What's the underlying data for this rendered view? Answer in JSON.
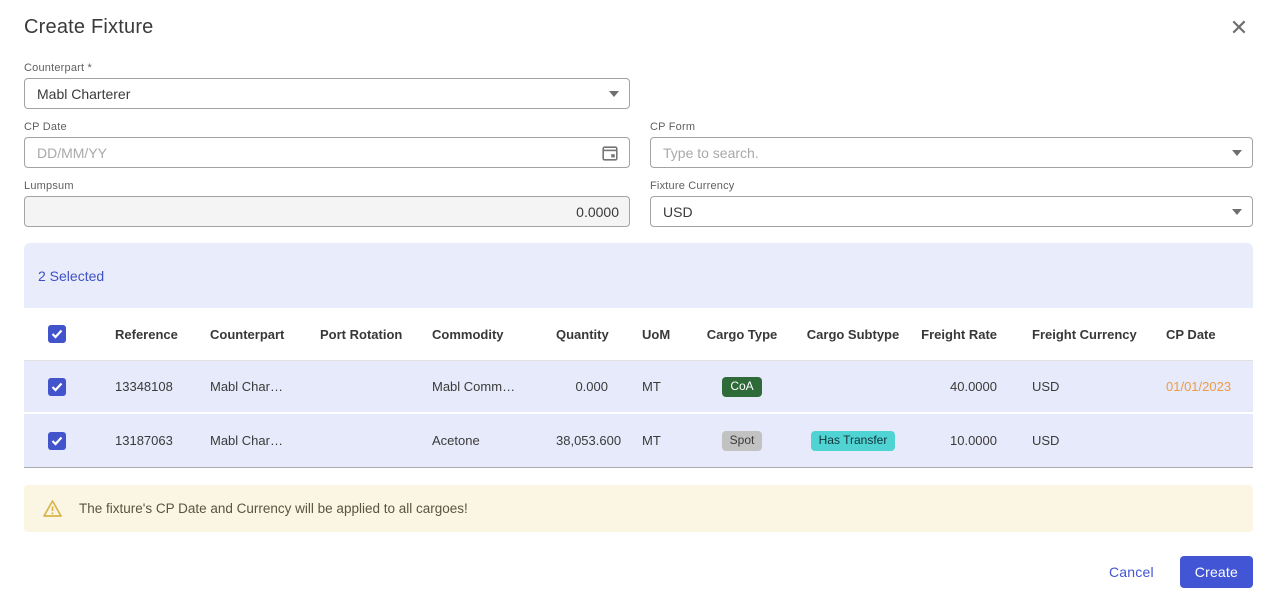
{
  "modal": {
    "title": "Create Fixture"
  },
  "form": {
    "counterpart": {
      "label": "Counterpart *",
      "value": "Mabl Charterer"
    },
    "cp_date": {
      "label": "CP Date",
      "placeholder": "DD/MM/YY"
    },
    "cp_form": {
      "label": "CP Form",
      "placeholder": "Type to search."
    },
    "lumpsum": {
      "label": "Lumpsum",
      "value": "0.0000"
    },
    "fixture_currency": {
      "label": "Fixture Currency",
      "value": "USD"
    }
  },
  "table": {
    "selected_count": "2 Selected",
    "headers": [
      "Reference",
      "Counterpart",
      "Port Rotation",
      "Commodity",
      "Quantity",
      "UoM",
      "Cargo Type",
      "Cargo Subtype",
      "Freight Rate",
      "Freight Currency",
      "CP Date"
    ],
    "rows": [
      {
        "reference": "13348108",
        "counterpart": "Mabl Char…",
        "port_rotation": "",
        "commodity": "Mabl Comm…",
        "quantity": "0.000",
        "uom": "MT",
        "cargo_type": "CoA",
        "cargo_subtype": "",
        "freight_rate": "40.0000",
        "freight_currency": "USD",
        "cp_date": "01/01/2023"
      },
      {
        "reference": "13187063",
        "counterpart": "Mabl Char…",
        "port_rotation": "",
        "commodity": "Acetone",
        "quantity": "38,053.600",
        "uom": "MT",
        "cargo_type": "Spot",
        "cargo_subtype": "Has Transfer",
        "freight_rate": "10.0000",
        "freight_currency": "USD",
        "cp_date": ""
      }
    ]
  },
  "warning": {
    "message": "The fixture's CP Date and Currency will be applied to all cargoes!"
  },
  "footer": {
    "cancel_label": "Cancel",
    "create_label": "Create"
  },
  "colors": {
    "accent_blue": "#4255d4",
    "checkbox_blue": "#4254cc",
    "row_lavender": "#e7eafa",
    "band_lavender": "#e9ecfb",
    "badge_green": "#2e6b39",
    "badge_gray": "#c2c2c2",
    "badge_teal": "#4fd3d3",
    "date_orange": "#ed9b45",
    "warning_bg": "#fbf6e3"
  }
}
